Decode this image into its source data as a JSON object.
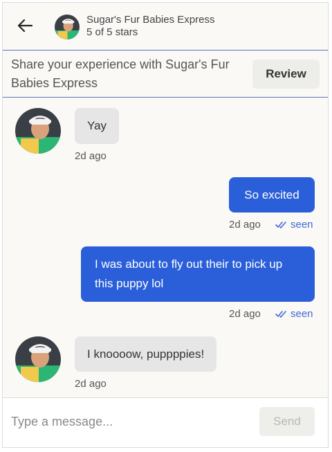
{
  "header": {
    "name": "Sugar's Fur Babies Express",
    "rating": "5 of 5 stars",
    "back_icon": "arrow-left-icon"
  },
  "review_banner": {
    "text": "Share your experience with Sugar's Fur Babies Express",
    "button_label": "Review"
  },
  "messages": [
    {
      "direction": "incoming",
      "text": "Yay",
      "time": "2d ago"
    },
    {
      "direction": "outgoing",
      "text": "So excited",
      "time": "2d ago",
      "status": "seen"
    },
    {
      "direction": "outgoing",
      "text": "I was about to fly out their to pick up this puppy lol",
      "time": "2d ago",
      "status": "seen"
    },
    {
      "direction": "incoming",
      "text": "I knoooow, puppppies!",
      "time": "2d ago"
    }
  ],
  "composer": {
    "placeholder": "Type a message...",
    "send_label": "Send"
  },
  "colors": {
    "outgoing_bubble": "#2b5fd9",
    "incoming_bubble": "#e6e6e6",
    "seen": "#4169d6",
    "divider": "#5b76b5"
  }
}
